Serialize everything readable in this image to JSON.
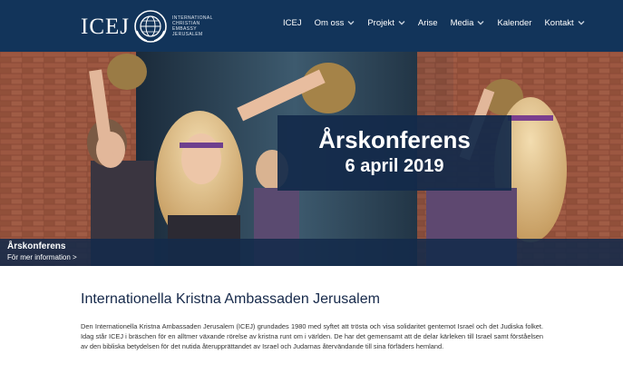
{
  "header": {
    "logo_word": "ICEJ",
    "logo_sub": [
      "INTERNATIONAL",
      "CHRISTIAN",
      "EMBASSY",
      "JERUSALEM"
    ],
    "logo_icon": "globe-emblem-icon",
    "nav": [
      {
        "label": "ICEJ",
        "dropdown": false
      },
      {
        "label": "Om oss",
        "dropdown": true
      },
      {
        "label": "Projekt",
        "dropdown": true
      },
      {
        "label": "Arise",
        "dropdown": false
      },
      {
        "label": "Media",
        "dropdown": true
      },
      {
        "label": "Kalender",
        "dropdown": false
      },
      {
        "label": "Kontakt",
        "dropdown": true
      }
    ]
  },
  "hero": {
    "title": "Årskonferens",
    "date": "6 april 2019",
    "caption_title": "Årskonferens",
    "caption_link": "För mer information >"
  },
  "content": {
    "title": "Internationella Kristna Ambassaden Jerusalem",
    "intro": "Den Internationella Kristna Ambassaden Jerusalem (ICEJ) grundades 1980 med syftet att trösta och visa solidaritet gentemot Israel och det Judiska folket. Idag står ICEJ i bräschen för en alltmer växande rörelse av kristna runt om i världen. De har det gemensamt att de delar kärleken till Israel samt förståelsen av den bibliska betydelsen för det nutida återupprättandet av Israel och Judarnas återvändande till sina förfäders hemland."
  },
  "colors": {
    "header_bg": "#12345a",
    "overlay": "#132a4a",
    "title_text": "#16294a"
  }
}
